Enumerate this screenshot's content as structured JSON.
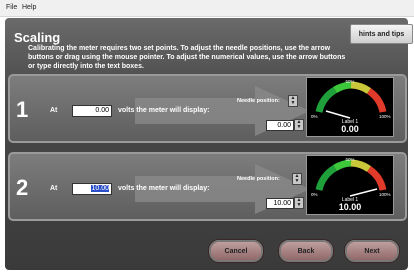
{
  "menu": {
    "file": "File",
    "help": "Help"
  },
  "header": {
    "title": "Scaling",
    "hints_label": "hints and tips",
    "description": "Calibrating the meter requires two set points. To adjust the needle positions, use the arrow buttons or drag using the mouse pointer. To adjust the numerical values, use the arrow buttons or type directly into the text boxes."
  },
  "rows": [
    {
      "number": "1",
      "at_label": "At",
      "volts_value": "0.00",
      "volts_suffix": "volts the meter will display:",
      "needle_label": "Needle position:",
      "position_value": "0.00",
      "meter": {
        "mark_50": "50%",
        "mark_0": "0%",
        "mark_100": "100%",
        "label": "Label 1",
        "value": "0.00",
        "needle_fraction": 0.0
      }
    },
    {
      "number": "2",
      "at_label": "At",
      "volts_value": "10.00",
      "volts_suffix": "volts the meter will display:",
      "needle_label": "Needle position:",
      "position_value": "10.00",
      "meter": {
        "mark_50": "50%",
        "mark_0": "0%",
        "mark_100": "100%",
        "label": "Label 1",
        "value": "10.00",
        "needle_fraction": 1.0
      }
    }
  ],
  "buttons": {
    "cancel": "Cancel",
    "back": "Back",
    "next": "Next"
  }
}
